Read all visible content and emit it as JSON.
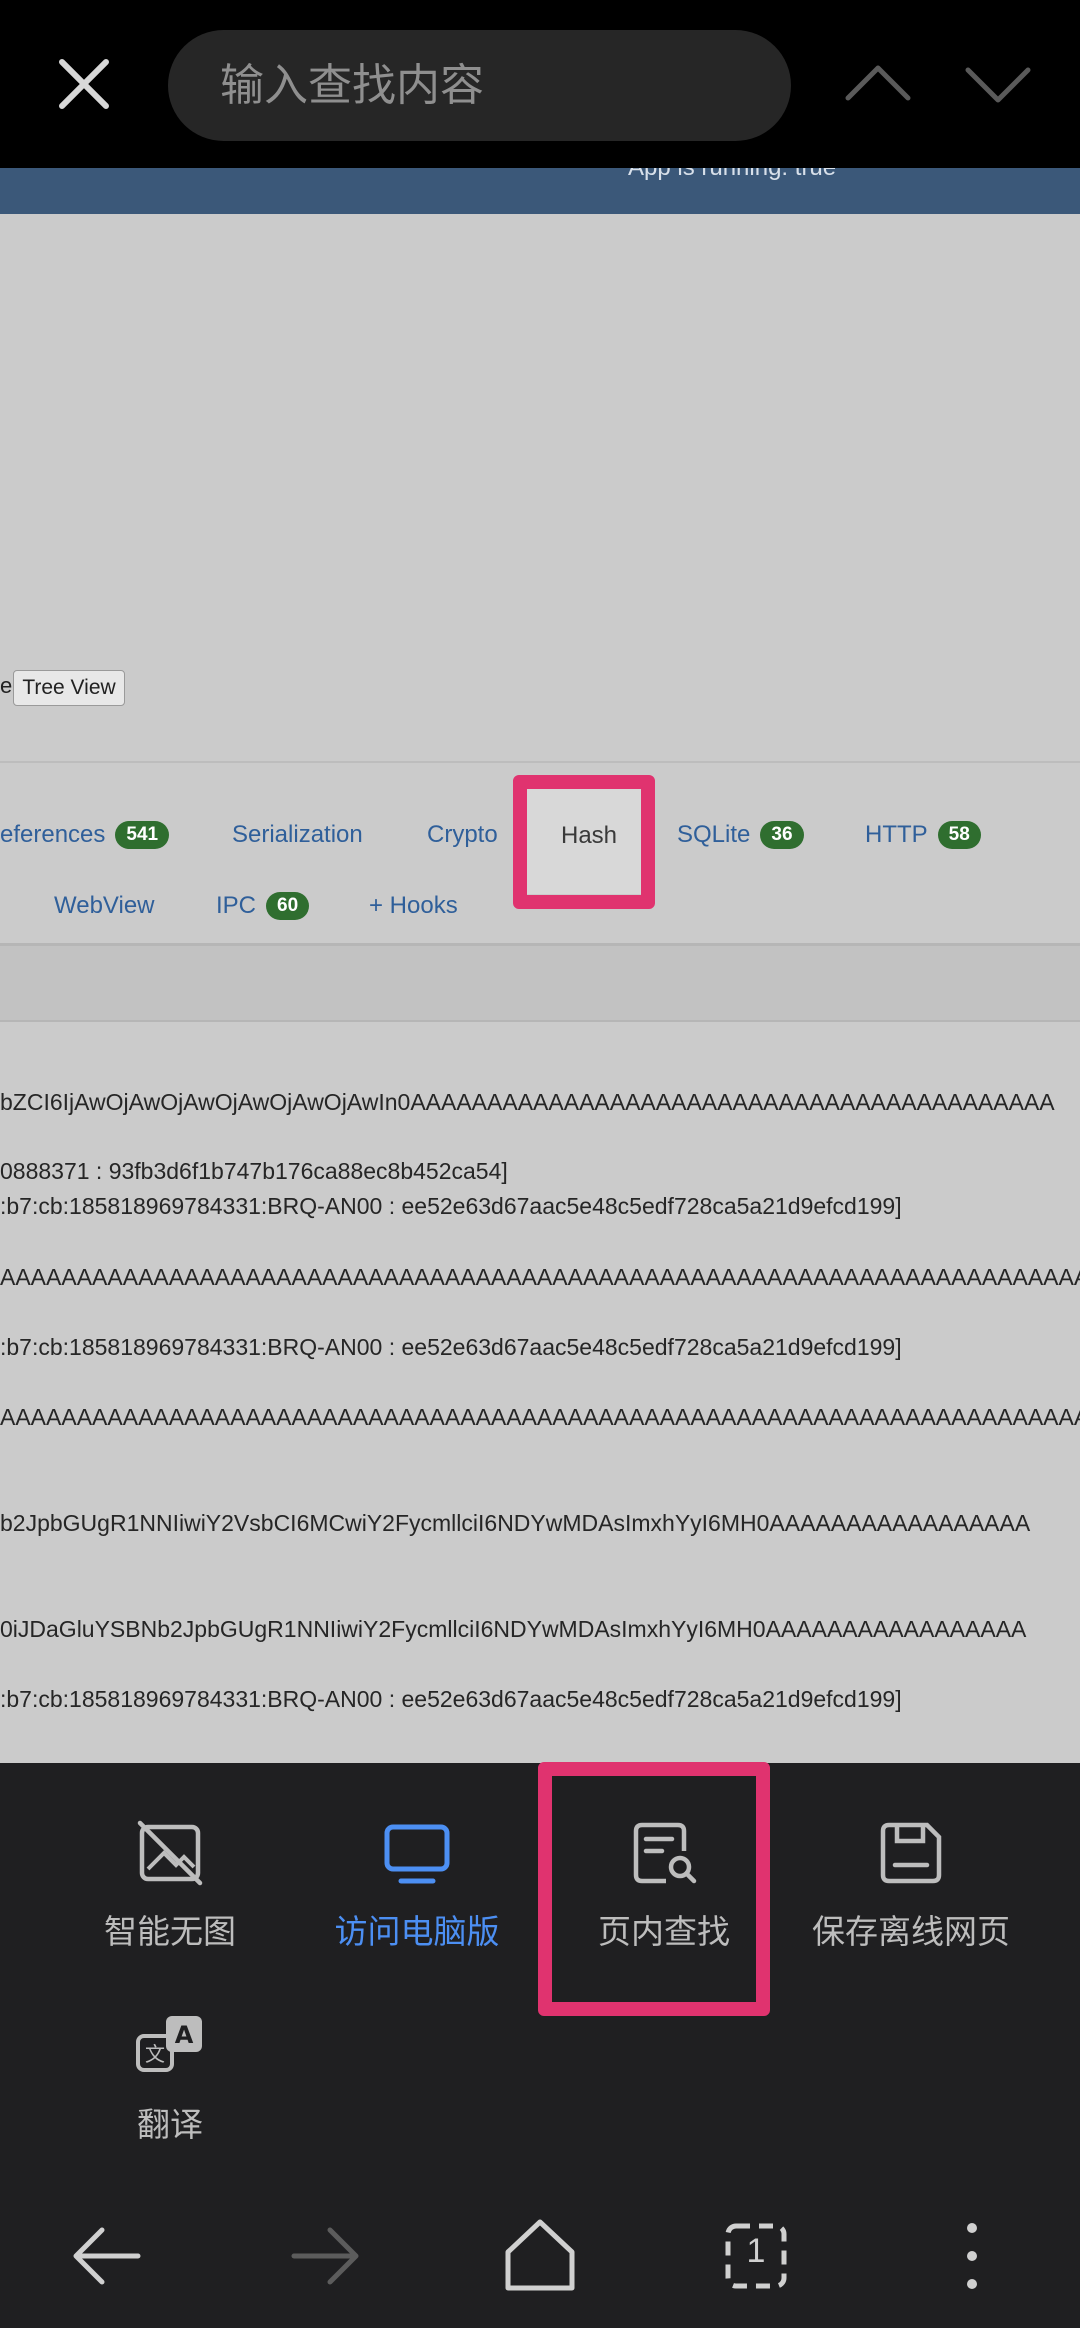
{
  "find_bar": {
    "placeholder": "输入查找内容",
    "icons": {
      "close": "close-icon",
      "prev": "chevron-up-icon",
      "next": "chevron-down-icon"
    }
  },
  "webpage": {
    "status_text": "App is running: true",
    "tree_prefix": "e",
    "tree_view_button": "Tree View",
    "tabs": {
      "references": {
        "label": "eferences",
        "count": "541"
      },
      "serialization": {
        "label": "Serialization"
      },
      "crypto": {
        "label": "Crypto"
      },
      "hash": {
        "label": "Hash"
      },
      "sqlite": {
        "label": "SQLite",
        "count": "36"
      },
      "http": {
        "label": "HTTP",
        "count": "58"
      },
      "webview": {
        "label": "WebView"
      },
      "ipc": {
        "label": "IPC",
        "count": "60"
      },
      "hooks": {
        "label": "+ Hooks"
      }
    },
    "log_lines": [
      "bZCI6IjAwOjAwOjAwOjAwOjAwOjAwIn0AAAAAAAAAAAAAAAAAAAAAAAAAAAAAAAAAAAAAAAAAA",
      "0888371 : 93fb3d6f1b747b176ca88ec8b452ca54]",
      ":b7:cb:185818969784331:BRQ-AN00 : ee52e63d67aac5e48c5edf728ca5a21d9efcd199]",
      "AAAAAAAAAAAAAAAAAAAAAAAAAAAAAAAAAAAAAAAAAAAAAAAAAAAAAAAAAAAAAAAAAAAAAAAAAA",
      ":b7:cb:185818969784331:BRQ-AN00 : ee52e63d67aac5e48c5edf728ca5a21d9efcd199]",
      "AAAAAAAAAAAAAAAAAAAAAAAAAAAAAAAAAAAAAAAAAAAAAAAAAAAAAAAAAAAAAAAAAAAAAAAAAA",
      "b2JpbGUgR1NNIiwiY2VsbCI6MCwiY2FycmllciI6NDYwMDAsImxhYyI6MH0AAAAAAAAAAAAAAAAA",
      "0iJDaGluYSBNb2JpbGUgR1NNIiwiY2FycmllciI6NDYwMDAsImxhYyI6MH0AAAAAAAAAAAAAAAAA",
      ":b7:cb:185818969784331:BRQ-AN00 : ee52e63d67aac5e48c5edf728ca5a21d9efcd199]"
    ]
  },
  "menu": {
    "items": [
      {
        "label": "智能无图",
        "icon": "no-image-icon",
        "color": "#bdbdbd"
      },
      {
        "label": "访问电脑版",
        "icon": "desktop-icon",
        "color": "#4c8ff3"
      },
      {
        "label": "页内查找",
        "icon": "find-in-page-icon",
        "color": "#bdbdbd"
      },
      {
        "label": "保存离线网页",
        "icon": "save-icon",
        "color": "#bdbdbd"
      },
      {
        "label": "翻译",
        "icon": "translate-icon",
        "color": "#bdbdbd"
      }
    ]
  },
  "nav": {
    "tab_count": "1",
    "icons": [
      "back-icon",
      "forward-icon",
      "home-icon",
      "tabs-icon",
      "more-icon"
    ]
  },
  "colors": {
    "highlight": "#e0336f",
    "accent_blue": "#4c8ff3",
    "badge_green": "#2f6e2f",
    "link_blue": "#2f5f9a"
  }
}
